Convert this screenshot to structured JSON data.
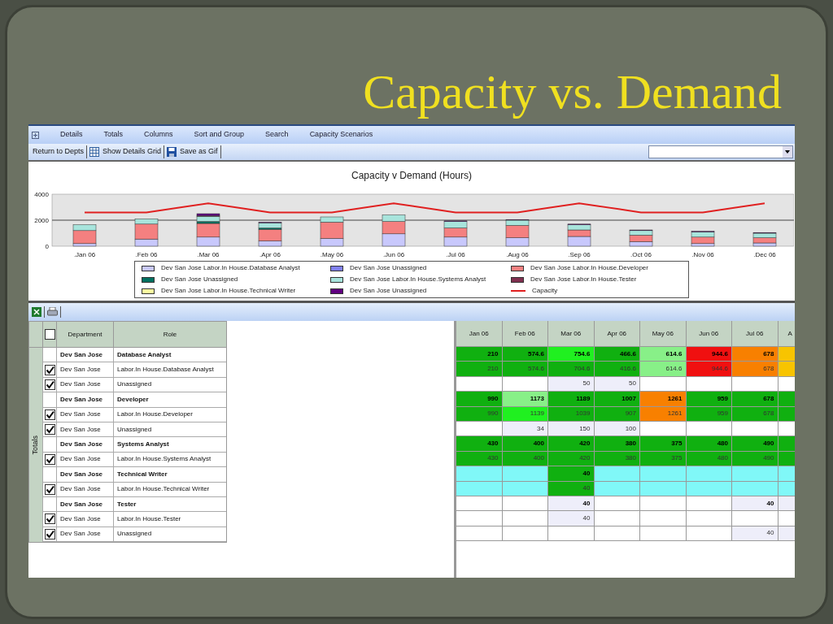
{
  "slide_title": "Capacity vs. Demand",
  "menu": [
    "Details",
    "Totals",
    "Columns",
    "Sort and Group",
    "Search",
    "Capacity Scenarios"
  ],
  "toolbar": [
    {
      "label": "Return to Depts",
      "kind": "text"
    },
    {
      "label": "Show Details Grid",
      "kind": "grid"
    },
    {
      "label": "Save as Gif",
      "kind": "save"
    }
  ],
  "chart": {
    "chart_data": {
      "type": "bar",
      "stacked": true,
      "title": "Capacity v Demand (Hours)",
      "categories": [
        ".Jan 06",
        ".Feb 06",
        ".Mar 06",
        ".Apr 06",
        ".May 06",
        ".Jun 06",
        ".Jul 06",
        ".Aug 06",
        ".Sep 06",
        ".Oct 06",
        ".Nov 06",
        ".Dec 06"
      ],
      "ylim": [
        0,
        4000
      ],
      "yticks": [
        0,
        2000,
        4000
      ],
      "series": [
        {
          "name": "Dev San Jose Labor.In House.Database Analyst",
          "color": "#c8c8fc",
          "values": [
            200,
            550,
            700,
            400,
            600,
            950,
            700,
            650,
            750,
            350,
            200,
            250
          ]
        },
        {
          "name": "Dev San Jose Unassigned",
          "color": "#8080f0",
          "values": [
            0,
            0,
            null,
            null,
            0,
            0,
            0,
            0,
            0,
            0,
            0,
            0
          ]
        },
        {
          "name": "Dev San Jose Labor.In House.Developer",
          "color": "#f48080",
          "values": [
            1000,
            1150,
            1050,
            900,
            1250,
            950,
            700,
            950,
            500,
            500,
            500,
            400
          ]
        },
        {
          "name": "Dev San Jose Unassigned",
          "color": "#007060",
          "values": [
            0,
            null,
            150,
            100,
            0,
            0,
            0,
            0,
            0,
            0,
            0,
            0
          ]
        },
        {
          "name": "Dev San Jose Labor.In House.Systems Analyst",
          "color": "#a8e4dc",
          "values": [
            450,
            400,
            400,
            400,
            400,
            500,
            500,
            400,
            400,
            350,
            400,
            350
          ]
        },
        {
          "name": "Dev San Jose Labor.In House.Tester",
          "color": "#803050",
          "values": [
            0,
            0,
            50,
            0,
            0,
            0,
            0,
            0,
            0,
            0,
            0,
            0
          ]
        },
        {
          "name": "Dev San Jose Labor.In House.Technical Writer",
          "color": "#ffffa0",
          "values": [
            0,
            0,
            0,
            0,
            0,
            0,
            0,
            0,
            0,
            0,
            0,
            0
          ]
        },
        {
          "name": "Dev San Jose Unassigned",
          "color": "#600080",
          "values": [
            0,
            0,
            150,
            50,
            0,
            0,
            50,
            50,
            50,
            50,
            50,
            50
          ]
        },
        {
          "name": "Capacity",
          "color": "#e02020",
          "type": "line",
          "values": [
            2600,
            2600,
            3300,
            2600,
            2600,
            3300,
            2600,
            2600,
            3300,
            2600,
            2600,
            3300
          ]
        }
      ],
      "legend": "bottom"
    }
  },
  "table": {
    "vertical_label": "Totals",
    "header_checked": false,
    "columns": [
      "Department",
      "Role"
    ],
    "rows": [
      {
        "kind": "group",
        "department": "Dev San Jose",
        "role": "Database Analyst"
      },
      {
        "kind": "item",
        "checked": true,
        "department": "Dev San Jose",
        "role": "Labor.In House.Database Analyst"
      },
      {
        "kind": "item",
        "checked": true,
        "department": "Dev San Jose",
        "role": "Unassigned"
      },
      {
        "kind": "group",
        "department": "Dev San Jose",
        "role": "Developer"
      },
      {
        "kind": "item",
        "checked": true,
        "department": "Dev San Jose",
        "role": "Labor.In House.Developer"
      },
      {
        "kind": "item",
        "checked": true,
        "department": "Dev San Jose",
        "role": "Unassigned"
      },
      {
        "kind": "group",
        "department": "Dev San Jose",
        "role": "Systems Analyst"
      },
      {
        "kind": "item",
        "checked": true,
        "department": "Dev San Jose",
        "role": "Labor.In House.Systems Analyst"
      },
      {
        "kind": "group",
        "department": "Dev San Jose",
        "role": "Technical Writer"
      },
      {
        "kind": "item",
        "checked": true,
        "department": "Dev San Jose",
        "role": "Labor.In House.Technical Writer"
      },
      {
        "kind": "group",
        "department": "Dev San Jose",
        "role": "Tester"
      },
      {
        "kind": "item",
        "checked": true,
        "department": "Dev San Jose",
        "role": "Labor.In House.Tester"
      },
      {
        "kind": "item",
        "checked": true,
        "department": "Dev San Jose",
        "role": "Unassigned"
      }
    ]
  },
  "month_grid": {
    "columns": [
      "Jan 06",
      "Feb 06",
      "Mar 06",
      "Apr 06",
      "May 06",
      "Jun 06",
      "Jul 06",
      "A"
    ],
    "rows": [
      {
        "kind": "group",
        "cells": [
          {
            "text": "210",
            "color": "#10b010"
          },
          {
            "text": "574.6",
            "color": "#10b010"
          },
          {
            "text": "754.6",
            "color": "#20f020"
          },
          {
            "text": "466.6",
            "color": "#10b010"
          },
          {
            "text": "614.6",
            "color": "#88f088"
          },
          {
            "text": "944.6",
            "color": "#f01010"
          },
          {
            "text": "678",
            "color": "#f88000"
          },
          {
            "color": "#f8c400"
          }
        ]
      },
      {
        "kind": "item",
        "cells": [
          {
            "text": "210",
            "color": "#10b010"
          },
          {
            "text": "574.6",
            "color": "#10b010"
          },
          {
            "text": "704.6",
            "color": "#10b010"
          },
          {
            "text": "416.6",
            "color": "#10b010"
          },
          {
            "text": "614.6",
            "color": "#88f088"
          },
          {
            "text": "944.6",
            "color": "#f01010"
          },
          {
            "text": "678",
            "color": "#f88000"
          },
          {
            "color": "#f8c400"
          }
        ]
      },
      {
        "kind": "item",
        "cells": [
          {
            "color": "#ffffff"
          },
          {
            "color": "#ffffff"
          },
          {
            "text": "50",
            "color": "#eeeefa"
          },
          {
            "text": "50",
            "color": "#eeeefa"
          },
          {
            "color": "#ffffff"
          },
          {
            "color": "#ffffff"
          },
          {
            "color": "#ffffff"
          },
          {
            "color": "#ffffff"
          }
        ]
      },
      {
        "kind": "group",
        "cells": [
          {
            "text": "990",
            "color": "#10b010"
          },
          {
            "text": "1173",
            "color": "#88f088"
          },
          {
            "text": "1189",
            "color": "#10b010"
          },
          {
            "text": "1007",
            "color": "#10b010"
          },
          {
            "text": "1261",
            "color": "#f88000"
          },
          {
            "text": "959",
            "color": "#10b010"
          },
          {
            "text": "678",
            "color": "#10b010"
          },
          {
            "color": "#10b010"
          }
        ]
      },
      {
        "kind": "item",
        "cells": [
          {
            "text": "990",
            "color": "#10b010"
          },
          {
            "text": "1139",
            "color": "#20f020"
          },
          {
            "text": "1039",
            "color": "#10b010"
          },
          {
            "text": "907",
            "color": "#10b010"
          },
          {
            "text": "1261",
            "color": "#f88000"
          },
          {
            "text": "959",
            "color": "#10b010"
          },
          {
            "text": "678",
            "color": "#10b010"
          },
          {
            "color": "#10b010"
          }
        ]
      },
      {
        "kind": "item",
        "cells": [
          {
            "color": "#ffffff"
          },
          {
            "text": "34",
            "color": "#eeeefa"
          },
          {
            "text": "150",
            "color": "#eeeefa"
          },
          {
            "text": "100",
            "color": "#eeeefa"
          },
          {
            "color": "#ffffff"
          },
          {
            "color": "#ffffff"
          },
          {
            "color": "#ffffff"
          },
          {
            "color": "#ffffff"
          }
        ]
      },
      {
        "kind": "group",
        "cells": [
          {
            "text": "430",
            "color": "#10b010"
          },
          {
            "text": "400",
            "color": "#10b010"
          },
          {
            "text": "420",
            "color": "#10b010"
          },
          {
            "text": "380",
            "color": "#10b010"
          },
          {
            "text": "375",
            "color": "#10b010"
          },
          {
            "text": "480",
            "color": "#10b010"
          },
          {
            "text": "490",
            "color": "#10b010"
          },
          {
            "color": "#10b010"
          }
        ]
      },
      {
        "kind": "item",
        "cells": [
          {
            "text": "430",
            "color": "#10b010"
          },
          {
            "text": "400",
            "color": "#10b010"
          },
          {
            "text": "420",
            "color": "#10b010"
          },
          {
            "text": "380",
            "color": "#10b010"
          },
          {
            "text": "375",
            "color": "#10b010"
          },
          {
            "text": "480",
            "color": "#10b010"
          },
          {
            "text": "490",
            "color": "#10b010"
          },
          {
            "color": "#10b010"
          }
        ]
      },
      {
        "kind": "group",
        "cells": [
          {
            "color": "#80f8f8"
          },
          {
            "color": "#80f8f8"
          },
          {
            "text": "40",
            "color": "#10b010"
          },
          {
            "color": "#80f8f8"
          },
          {
            "color": "#80f8f8"
          },
          {
            "color": "#80f8f8"
          },
          {
            "color": "#80f8f8"
          },
          {
            "color": "#80f8f8"
          }
        ]
      },
      {
        "kind": "item",
        "cells": [
          {
            "color": "#80f8f8"
          },
          {
            "color": "#80f8f8"
          },
          {
            "text": "40",
            "color": "#10b010"
          },
          {
            "color": "#80f8f8"
          },
          {
            "color": "#80f8f8"
          },
          {
            "color": "#80f8f8"
          },
          {
            "color": "#80f8f8"
          },
          {
            "color": "#80f8f8"
          }
        ]
      },
      {
        "kind": "group",
        "cells": [
          {
            "color": "#ffffff"
          },
          {
            "color": "#ffffff"
          },
          {
            "text": "40",
            "color": "#eeeefa"
          },
          {
            "color": "#ffffff"
          },
          {
            "color": "#ffffff"
          },
          {
            "color": "#ffffff"
          },
          {
            "text": "40",
            "color": "#eeeefa"
          },
          {
            "color": "#eeeefa"
          }
        ]
      },
      {
        "kind": "item",
        "cells": [
          {
            "color": "#ffffff"
          },
          {
            "color": "#ffffff"
          },
          {
            "text": "40",
            "color": "#eeeefa"
          },
          {
            "color": "#ffffff"
          },
          {
            "color": "#ffffff"
          },
          {
            "color": "#ffffff"
          },
          {
            "color": "#ffffff"
          },
          {
            "color": "#ffffff"
          }
        ]
      },
      {
        "kind": "item",
        "cells": [
          {
            "color": "#ffffff"
          },
          {
            "color": "#ffffff"
          },
          {
            "color": "#ffffff"
          },
          {
            "color": "#ffffff"
          },
          {
            "color": "#ffffff"
          },
          {
            "color": "#ffffff"
          },
          {
            "text": "40",
            "color": "#eeeefa"
          },
          {
            "color": "#eeeefa"
          }
        ]
      }
    ]
  }
}
